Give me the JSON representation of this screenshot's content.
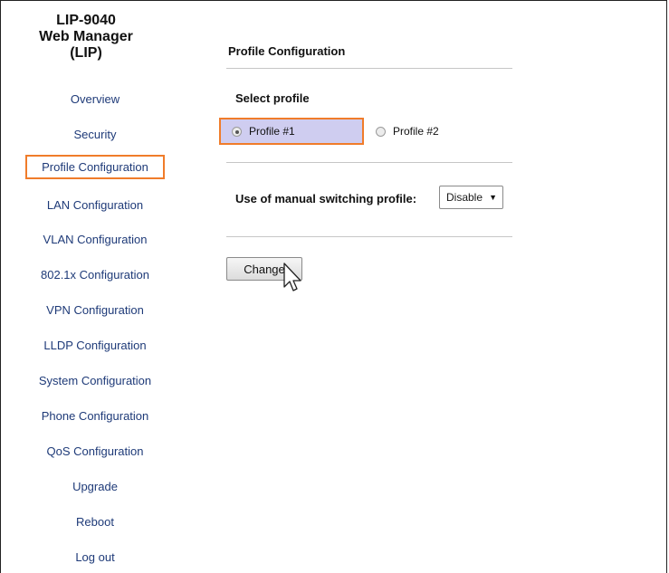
{
  "app": {
    "title_lines": [
      "LIP-9040",
      "Web Manager",
      "(LIP)"
    ]
  },
  "sidebar": {
    "items": [
      {
        "label": "Overview"
      },
      {
        "label": "Security"
      },
      {
        "label": "Profile Configuration",
        "active": true
      },
      {
        "label": "LAN Configuration"
      },
      {
        "label": "VLAN Configuration"
      },
      {
        "label": "802.1x Configuration"
      },
      {
        "label": "VPN Configuration"
      },
      {
        "label": "LLDP Configuration"
      },
      {
        "label": "System Configuration"
      },
      {
        "label": "Phone Configuration"
      },
      {
        "label": "QoS Configuration"
      },
      {
        "label": "Upgrade"
      },
      {
        "label": "Reboot"
      },
      {
        "label": "Log out"
      }
    ]
  },
  "main": {
    "title": "Profile Configuration",
    "select_profile": {
      "label": "Select profile",
      "options": [
        {
          "label": "Profile #1",
          "selected": true
        },
        {
          "label": "Profile #2",
          "selected": false
        }
      ]
    },
    "manual_switching": {
      "label": "Use of manual switching profile:",
      "value": "Disable"
    },
    "change_button": "Change"
  },
  "colors": {
    "nav_link": "#1e3a78",
    "highlight_border": "#f07c2a",
    "selected_background": "#cfcdf0"
  },
  "icons": {
    "cursor": "mouse-pointer-icon",
    "dropdown": "triangle-down-icon"
  }
}
